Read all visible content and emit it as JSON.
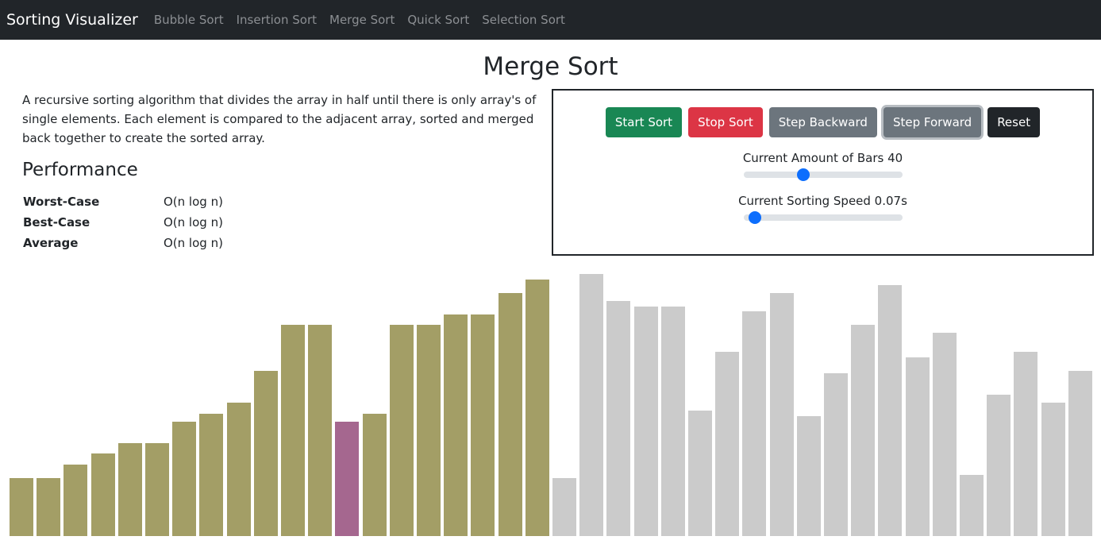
{
  "nav": {
    "brand": "Sorting Visualizer",
    "links": [
      "Bubble Sort",
      "Insertion Sort",
      "Merge Sort",
      "Quick Sort",
      "Selection Sort"
    ]
  },
  "title": "Merge Sort",
  "description": "A recursive sorting algorithm that divides the array in half until there is only array's of single elements. Each element is compared to the adjacent array, sorted and merged back together to create the sorted array.",
  "performance": {
    "heading": "Performance",
    "rows": [
      {
        "label": "Worst-Case",
        "value": "O(n log n)"
      },
      {
        "label": "Best-Case",
        "value": "O(n log n)"
      },
      {
        "label": "Average",
        "value": "O(n log n)"
      }
    ]
  },
  "controls": {
    "buttons": [
      "Start Sort",
      "Stop Sort",
      "Step Backward",
      "Step Forward",
      "Reset"
    ],
    "bars_label": "Current Amount of Bars 40",
    "bars_value": 40,
    "bars_slider_fraction": 0.375,
    "speed_label": "Current Sorting Speed 0.07s",
    "speed_value": 0.07,
    "speed_slider_fraction": 0.07
  },
  "colors": {
    "sorted": "#a39e66",
    "active": "#a5678f",
    "unsorted": "#cbcbcb"
  },
  "array": {
    "values": [
      73,
      73,
      90,
      104,
      117,
      117,
      144,
      154,
      168,
      208,
      266,
      266,
      144,
      154,
      266,
      266,
      279,
      279,
      306,
      323,
      73,
      330,
      296,
      289,
      289,
      158,
      232,
      283,
      306,
      151,
      205,
      266,
      316,
      225,
      256,
      77,
      178,
      232,
      168,
      208
    ],
    "states": [
      "sorted",
      "sorted",
      "sorted",
      "sorted",
      "sorted",
      "sorted",
      "sorted",
      "sorted",
      "sorted",
      "sorted",
      "sorted",
      "sorted",
      "active",
      "sorted",
      "sorted",
      "sorted",
      "sorted",
      "sorted",
      "sorted",
      "sorted",
      "unsorted",
      "unsorted",
      "unsorted",
      "unsorted",
      "unsorted",
      "unsorted",
      "unsorted",
      "unsorted",
      "unsorted",
      "unsorted",
      "unsorted",
      "unsorted",
      "unsorted",
      "unsorted",
      "unsorted",
      "unsorted",
      "unsorted",
      "unsorted",
      "unsorted",
      "unsorted"
    ]
  }
}
